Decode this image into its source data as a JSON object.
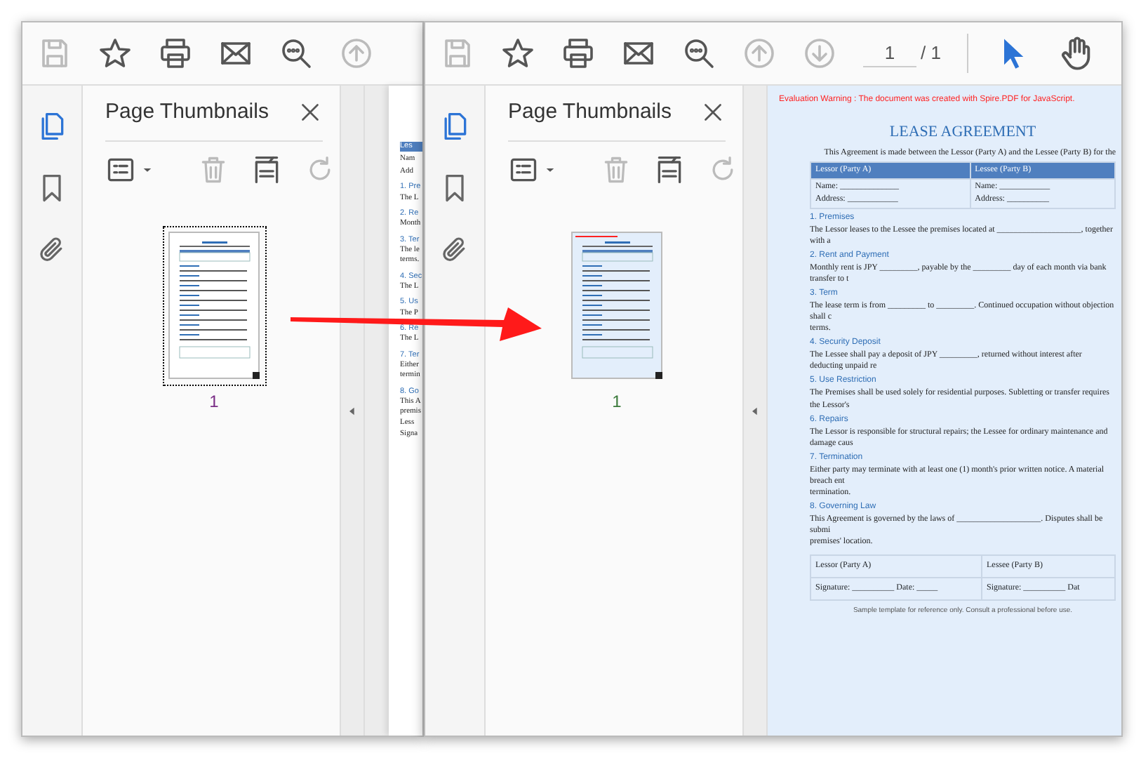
{
  "windows": [
    {
      "toolbar": [
        {
          "kind": "save",
          "disabled": true
        },
        {
          "kind": "star",
          "disabled": false
        },
        {
          "kind": "print",
          "disabled": false
        },
        {
          "kind": "mail",
          "disabled": false
        },
        {
          "kind": "search",
          "disabled": false
        },
        {
          "kind": "up",
          "disabled": true
        }
      ],
      "rail": [
        {
          "kind": "pages",
          "selected": true
        },
        {
          "kind": "bookmark",
          "selected": false
        },
        {
          "kind": "attach",
          "selected": false
        }
      ],
      "panel": {
        "title": "Page Thumbnails",
        "tools": [
          {
            "kind": "options",
            "disabled": false
          },
          {
            "kind": "trash",
            "disabled": true
          },
          {
            "kind": "extract",
            "disabled": false
          },
          {
            "kind": "rotate",
            "disabled": true
          }
        ],
        "thumbnails": [
          {
            "label": "1",
            "selected": true
          }
        ]
      },
      "document": {
        "tinted": false,
        "fragments": [
          {
            "kind": "table-head",
            "text": "Les"
          },
          {
            "kind": "cell",
            "text": "Nam"
          },
          {
            "kind": "cell",
            "text": "Add"
          },
          {
            "kind": "heading",
            "text": "1. Pre"
          },
          {
            "kind": "text",
            "text": "The L"
          },
          {
            "kind": "heading",
            "text": "2. Re"
          },
          {
            "kind": "text",
            "text": "Month"
          },
          {
            "kind": "heading",
            "text": "3. Ter"
          },
          {
            "kind": "text",
            "text": "The le"
          },
          {
            "kind": "text",
            "text": "terms."
          },
          {
            "kind": "heading",
            "text": "4. Sec"
          },
          {
            "kind": "text",
            "text": "The L"
          },
          {
            "kind": "heading",
            "text": "5. Us"
          },
          {
            "kind": "text",
            "text": "The P"
          },
          {
            "kind": "heading",
            "text": "6. Re"
          },
          {
            "kind": "text",
            "text": "The L"
          },
          {
            "kind": "heading",
            "text": "7. Ter"
          },
          {
            "kind": "text",
            "text": "Either"
          },
          {
            "kind": "text",
            "text": "termin"
          },
          {
            "kind": "heading",
            "text": "8. Go"
          },
          {
            "kind": "text",
            "text": "This A"
          },
          {
            "kind": "text",
            "text": "premis"
          },
          {
            "kind": "cell",
            "text": "Less"
          },
          {
            "kind": "cell",
            "text": "Signa"
          }
        ]
      }
    },
    {
      "toolbar": [
        {
          "kind": "save",
          "disabled": true
        },
        {
          "kind": "star",
          "disabled": false
        },
        {
          "kind": "print",
          "disabled": false
        },
        {
          "kind": "mail",
          "disabled": false
        },
        {
          "kind": "search",
          "disabled": false
        },
        {
          "kind": "up",
          "disabled": true
        },
        {
          "kind": "down",
          "disabled": true
        }
      ],
      "page_field": {
        "value": "1",
        "total": "/ 1"
      },
      "tools": [
        {
          "kind": "pointer",
          "selected": true
        },
        {
          "kind": "hand",
          "selected": false
        }
      ],
      "rail": [
        {
          "kind": "pages",
          "selected": true
        },
        {
          "kind": "bookmark",
          "selected": false
        },
        {
          "kind": "attach",
          "selected": false
        }
      ],
      "panel": {
        "title": "Page Thumbnails",
        "tools": [
          {
            "kind": "options",
            "disabled": false
          },
          {
            "kind": "trash",
            "disabled": true
          },
          {
            "kind": "extract",
            "disabled": false
          },
          {
            "kind": "rotate",
            "disabled": true
          }
        ],
        "thumbnails": [
          {
            "label": "1",
            "selected": false
          }
        ]
      },
      "document": {
        "tinted": true,
        "warning": "Evaluation Warning : The document was created with Spire.PDF for JavaScript.",
        "title": "LEASE AGREEMENT",
        "intro": "This Agreement is made between the Lessor (Party A) and the Lessee (Party B) for the",
        "parties": {
          "headers": [
            "Lessor (Party A)",
            "Lessee (Party B)"
          ],
          "cells": [
            [
              "Name: ______________",
              "Address: ____________"
            ],
            [
              "Name: ____________",
              "Address: __________"
            ]
          ]
        },
        "sections": [
          {
            "heading": "1. Premises",
            "lines": [
              "The Lessor leases to the Lessee the premises located at ____________________, together with a"
            ]
          },
          {
            "heading": "2. Rent and Payment",
            "lines": [
              "Monthly rent is JPY _________, payable by the _________ day of each month via bank transfer to t"
            ]
          },
          {
            "heading": "3. Term",
            "lines": [
              "The lease term is from _________ to _________. Continued occupation without objection shall c",
              "terms."
            ]
          },
          {
            "heading": "4. Security Deposit",
            "lines": [
              "The Lessee shall pay a deposit of JPY _________, returned without interest after deducting unpaid re"
            ]
          },
          {
            "heading": "5. Use Restriction",
            "lines": [
              "The Premises shall be used solely for residential purposes. Subletting or transfer requires the Lessor's"
            ]
          },
          {
            "heading": "6. Repairs",
            "lines": [
              "The Lessor is responsible for structural repairs; the Lessee for ordinary maintenance and damage caus"
            ]
          },
          {
            "heading": "7. Termination",
            "lines": [
              "Either party may terminate with at least one (1) month's prior written notice. A material breach ent",
              "termination."
            ]
          },
          {
            "heading": "8. Governing Law",
            "lines": [
              "This Agreement is governed by the laws of ____________________. Disputes shall be submi",
              "premises' location."
            ]
          }
        ],
        "signatures": [
          [
            "Lessor (Party A)",
            "Lessee (Party B)"
          ],
          [
            "Signature: __________ Date: _____",
            "Signature: __________ Dat"
          ]
        ],
        "footer": "Sample template for reference only. Consult a professional before use."
      }
    }
  ]
}
